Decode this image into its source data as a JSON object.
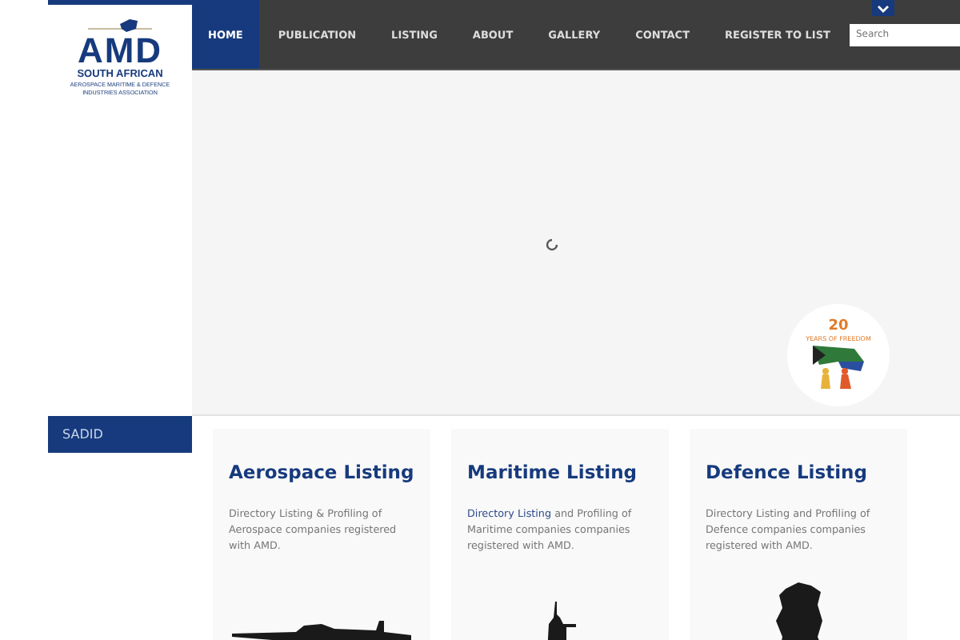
{
  "logo": {
    "title": "AMD",
    "subtitle": "SOUTH AFRICAN",
    "tagline_1": "AEROSPACE MARITIME & DEFENCE",
    "tagline_2": "INDUSTRIES ASSOCIATION"
  },
  "nav": {
    "items": [
      {
        "label": "HOME",
        "selected": true
      },
      {
        "label": "PUBLICATION",
        "selected": false
      },
      {
        "label": "LISTING",
        "selected": false
      },
      {
        "label": "ABOUT",
        "selected": false
      },
      {
        "label": "GALLERY",
        "selected": false
      },
      {
        "label": "CONTACT",
        "selected": false
      },
      {
        "label": "REGISTER TO LIST",
        "selected": false
      }
    ],
    "search": {
      "placeholder": "Search"
    }
  },
  "badge": {
    "number": "20",
    "text": "YEARS OF FREEDOM"
  },
  "sidebar": {
    "items": [
      {
        "label": "SADID"
      }
    ]
  },
  "cards": [
    {
      "title": "Aerospace Listing",
      "text": "Directory Listing & Profiling of Aerospace companies registered with AMD.",
      "kind": "plane"
    },
    {
      "title": "Maritime Listing",
      "link": "Directory Listing",
      "text": " and Profiling of Maritime companies companies registered with AMD.",
      "kind": "ship"
    },
    {
      "title": "Defence Listing",
      "text": "Directory Listing and Profiling of Defence companies companies registered with AMD.",
      "kind": "soldier"
    }
  ]
}
